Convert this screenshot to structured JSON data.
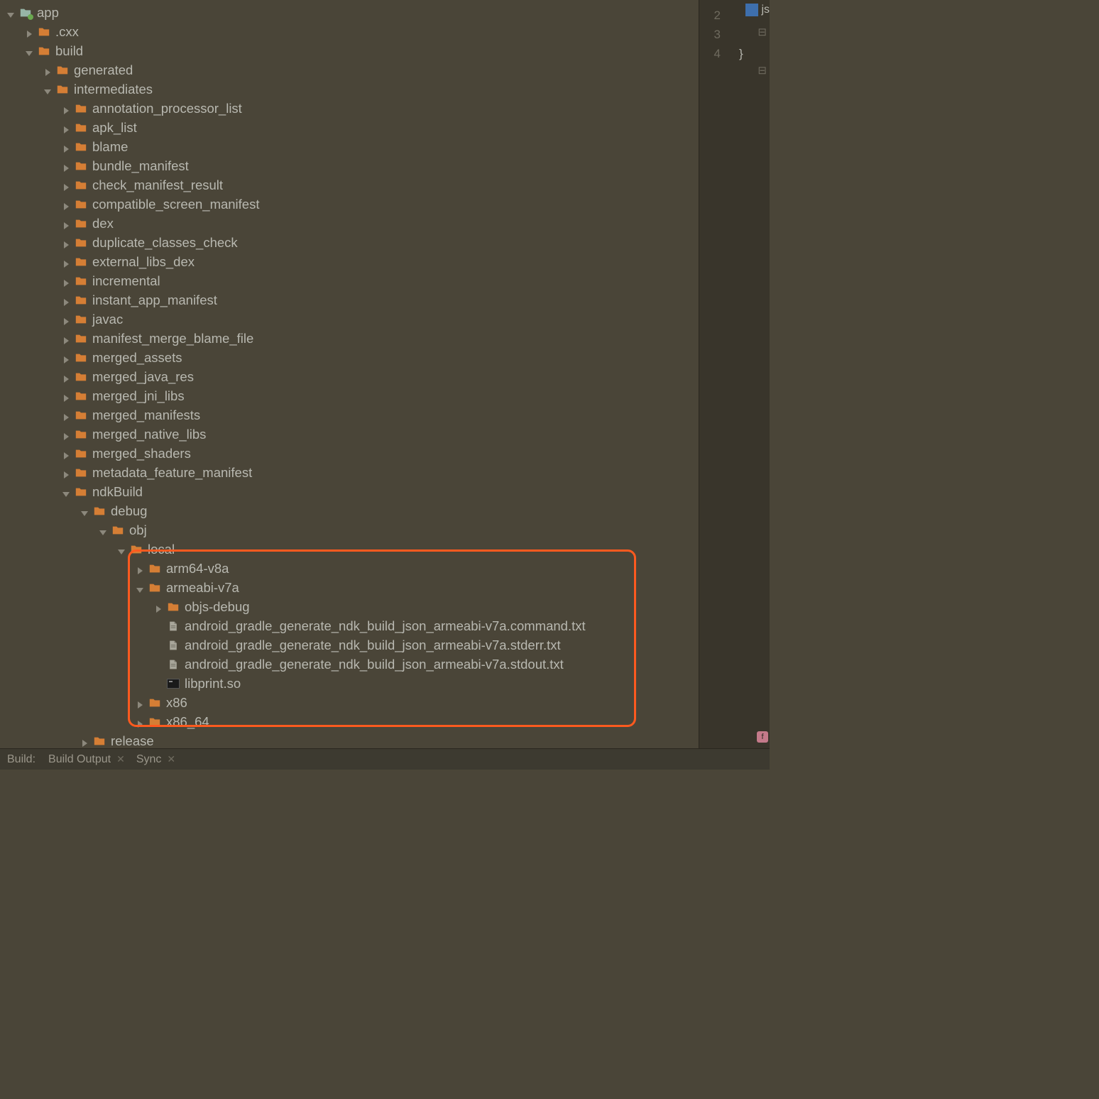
{
  "tree": {
    "app": "app",
    "cxx": ".cxx",
    "build": "build",
    "generated": "generated",
    "intermediates": "intermediates",
    "items": [
      "annotation_processor_list",
      "apk_list",
      "blame",
      "bundle_manifest",
      "check_manifest_result",
      "compatible_screen_manifest",
      "dex",
      "duplicate_classes_check",
      "external_libs_dex",
      "incremental",
      "instant_app_manifest",
      "javac",
      "manifest_merge_blame_file",
      "merged_assets",
      "merged_java_res",
      "merged_jni_libs",
      "merged_manifests",
      "merged_native_libs",
      "merged_shaders",
      "metadata_feature_manifest"
    ],
    "ndkBuild": "ndkBuild",
    "debug": "debug",
    "obj": "obj",
    "local": "local",
    "arm64": "arm64-v8a",
    "armeabi": "armeabi-v7a",
    "objsdebug": "objs-debug",
    "files": [
      "android_gradle_generate_ndk_build_json_armeabi-v7a.command.txt",
      "android_gradle_generate_ndk_build_json_armeabi-v7a.stderr.txt",
      "android_gradle_generate_ndk_build_json_armeabi-v7a.stdout.txt"
    ],
    "libprint": "libprint.so",
    "x86": "x86",
    "x86_64": "x86_64",
    "release": "release"
  },
  "bottom": {
    "build": "Build:",
    "buildOutput": "Build Output",
    "sync": "Sync"
  },
  "editor": {
    "tab": "js",
    "line2": "2",
    "line3": "3",
    "line4": "4",
    "brace": "}"
  }
}
